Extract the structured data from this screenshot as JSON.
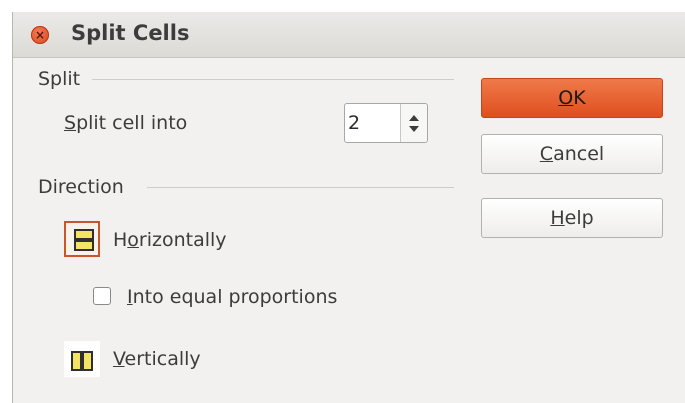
{
  "window": {
    "title": "Split Cells",
    "close_glyph": "×"
  },
  "split_section": {
    "label": "Split",
    "split_into": {
      "label_accel": "S",
      "label_rest": "plit cell into",
      "value": "2"
    }
  },
  "direction_section": {
    "label": "Direction",
    "horizontally": {
      "pre": "H",
      "accel": "o",
      "rest": "rizontally",
      "selected": true,
      "icon": "split-horizontal-icon"
    },
    "equal_proportions": {
      "accel": "I",
      "rest": "nto equal proportions",
      "checked": false
    },
    "vertically": {
      "accel": "V",
      "rest": "ertically",
      "selected": false,
      "icon": "split-vertical-icon"
    }
  },
  "buttons": {
    "ok": {
      "accel": "O",
      "rest": "K"
    },
    "cancel": {
      "accel": "C",
      "rest": "ancel"
    },
    "help": {
      "accel": "H",
      "rest": "elp"
    }
  },
  "colors": {
    "accent": "#df4e1e",
    "icon_fill": "#f5e463",
    "dialog_bg": "#f2f1f0"
  }
}
